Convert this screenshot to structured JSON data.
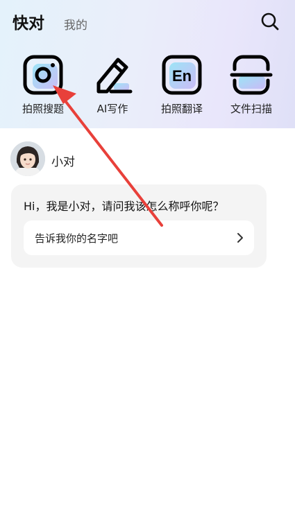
{
  "header": {
    "tab_active": "快对",
    "tab_inactive": "我的"
  },
  "tools": [
    {
      "label": "拍照搜题",
      "icon": "camera-icon"
    },
    {
      "label": "AI写作",
      "icon": "pen-icon"
    },
    {
      "label": "拍照翻译",
      "icon": "translate-icon"
    },
    {
      "label": "文件扫描",
      "icon": "scan-icon"
    }
  ],
  "chat": {
    "bot_name": "小对",
    "message": "Hi，我是小对，请问我该怎么称呼你呢？",
    "suggestion": "告诉我你的名字吧"
  },
  "colors": {
    "annotation_arrow": "#e8403a",
    "header_gradient_start": "#e4f2fb",
    "header_gradient_end": "#dfe0f7"
  }
}
